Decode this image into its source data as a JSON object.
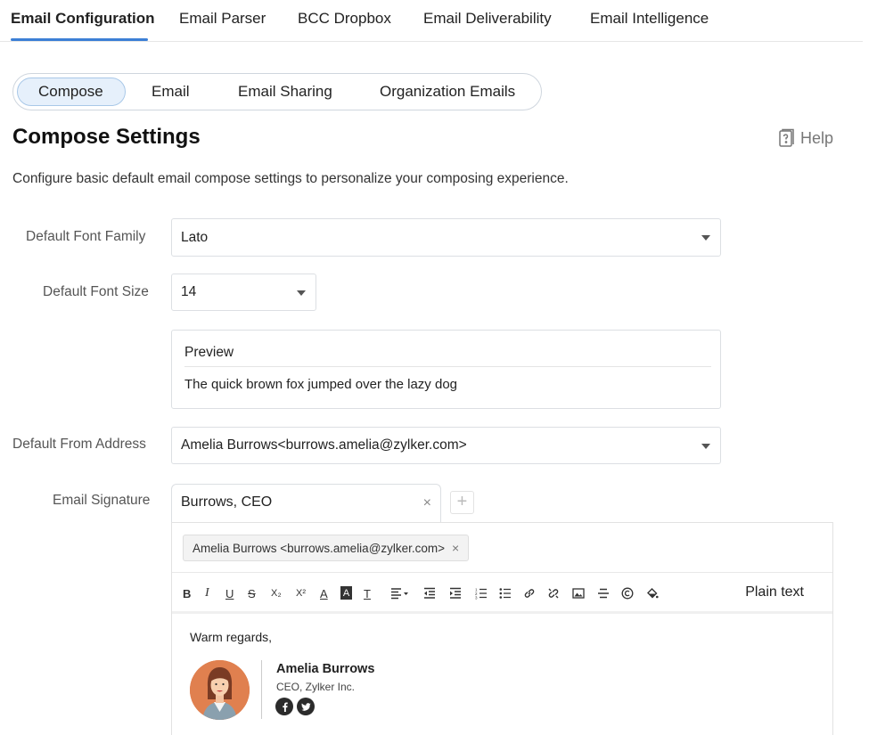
{
  "top_tabs": [
    {
      "label": "Email Configuration",
      "active": true
    },
    {
      "label": "Email Parser"
    },
    {
      "label": "BCC Dropbox"
    },
    {
      "label": "Email Deliverability"
    },
    {
      "label": "Email Intelligence"
    }
  ],
  "sub_tabs": [
    {
      "label": "Compose",
      "active": true
    },
    {
      "label": "Email"
    },
    {
      "label": "Email Sharing"
    },
    {
      "label": "Organization Emails"
    }
  ],
  "page": {
    "title": "Compose Settings",
    "help_label": "Help",
    "description": "Configure basic default email compose settings to personalize your composing experience."
  },
  "fields": {
    "font_family": {
      "label": "Default Font Family",
      "value": "Lato"
    },
    "font_size": {
      "label": "Default Font Size",
      "value": "14"
    },
    "preview": {
      "title": "Preview",
      "text": "The quick brown fox jumped over the lazy dog"
    },
    "from_address": {
      "label": "Default From Address",
      "value": "Amelia Burrows<burrows.amelia@zylker.com>"
    },
    "signature": {
      "label": "Email Signature",
      "selected": "Burrows, CEO",
      "add_symbol": "+",
      "close_symbol": "×",
      "chip": "Amelia Burrows <burrows.amelia@zylker.com>",
      "plain_text_label": "Plain text",
      "greeting": "Warm regards,",
      "name": "Amelia Burrows",
      "title": "CEO, Zylker Inc."
    }
  },
  "toolbar": {
    "bold": "B",
    "italic": "I",
    "underline": "U",
    "strike": "S",
    "subscript": "X₂",
    "superscript": "X²",
    "font_color": "A",
    "bg_color": "A",
    "clear_format": "T"
  },
  "colors": {
    "accent": "#3c7fd6",
    "pill_bg": "#e6f0fb",
    "avatar_bg": "#e0804f"
  }
}
